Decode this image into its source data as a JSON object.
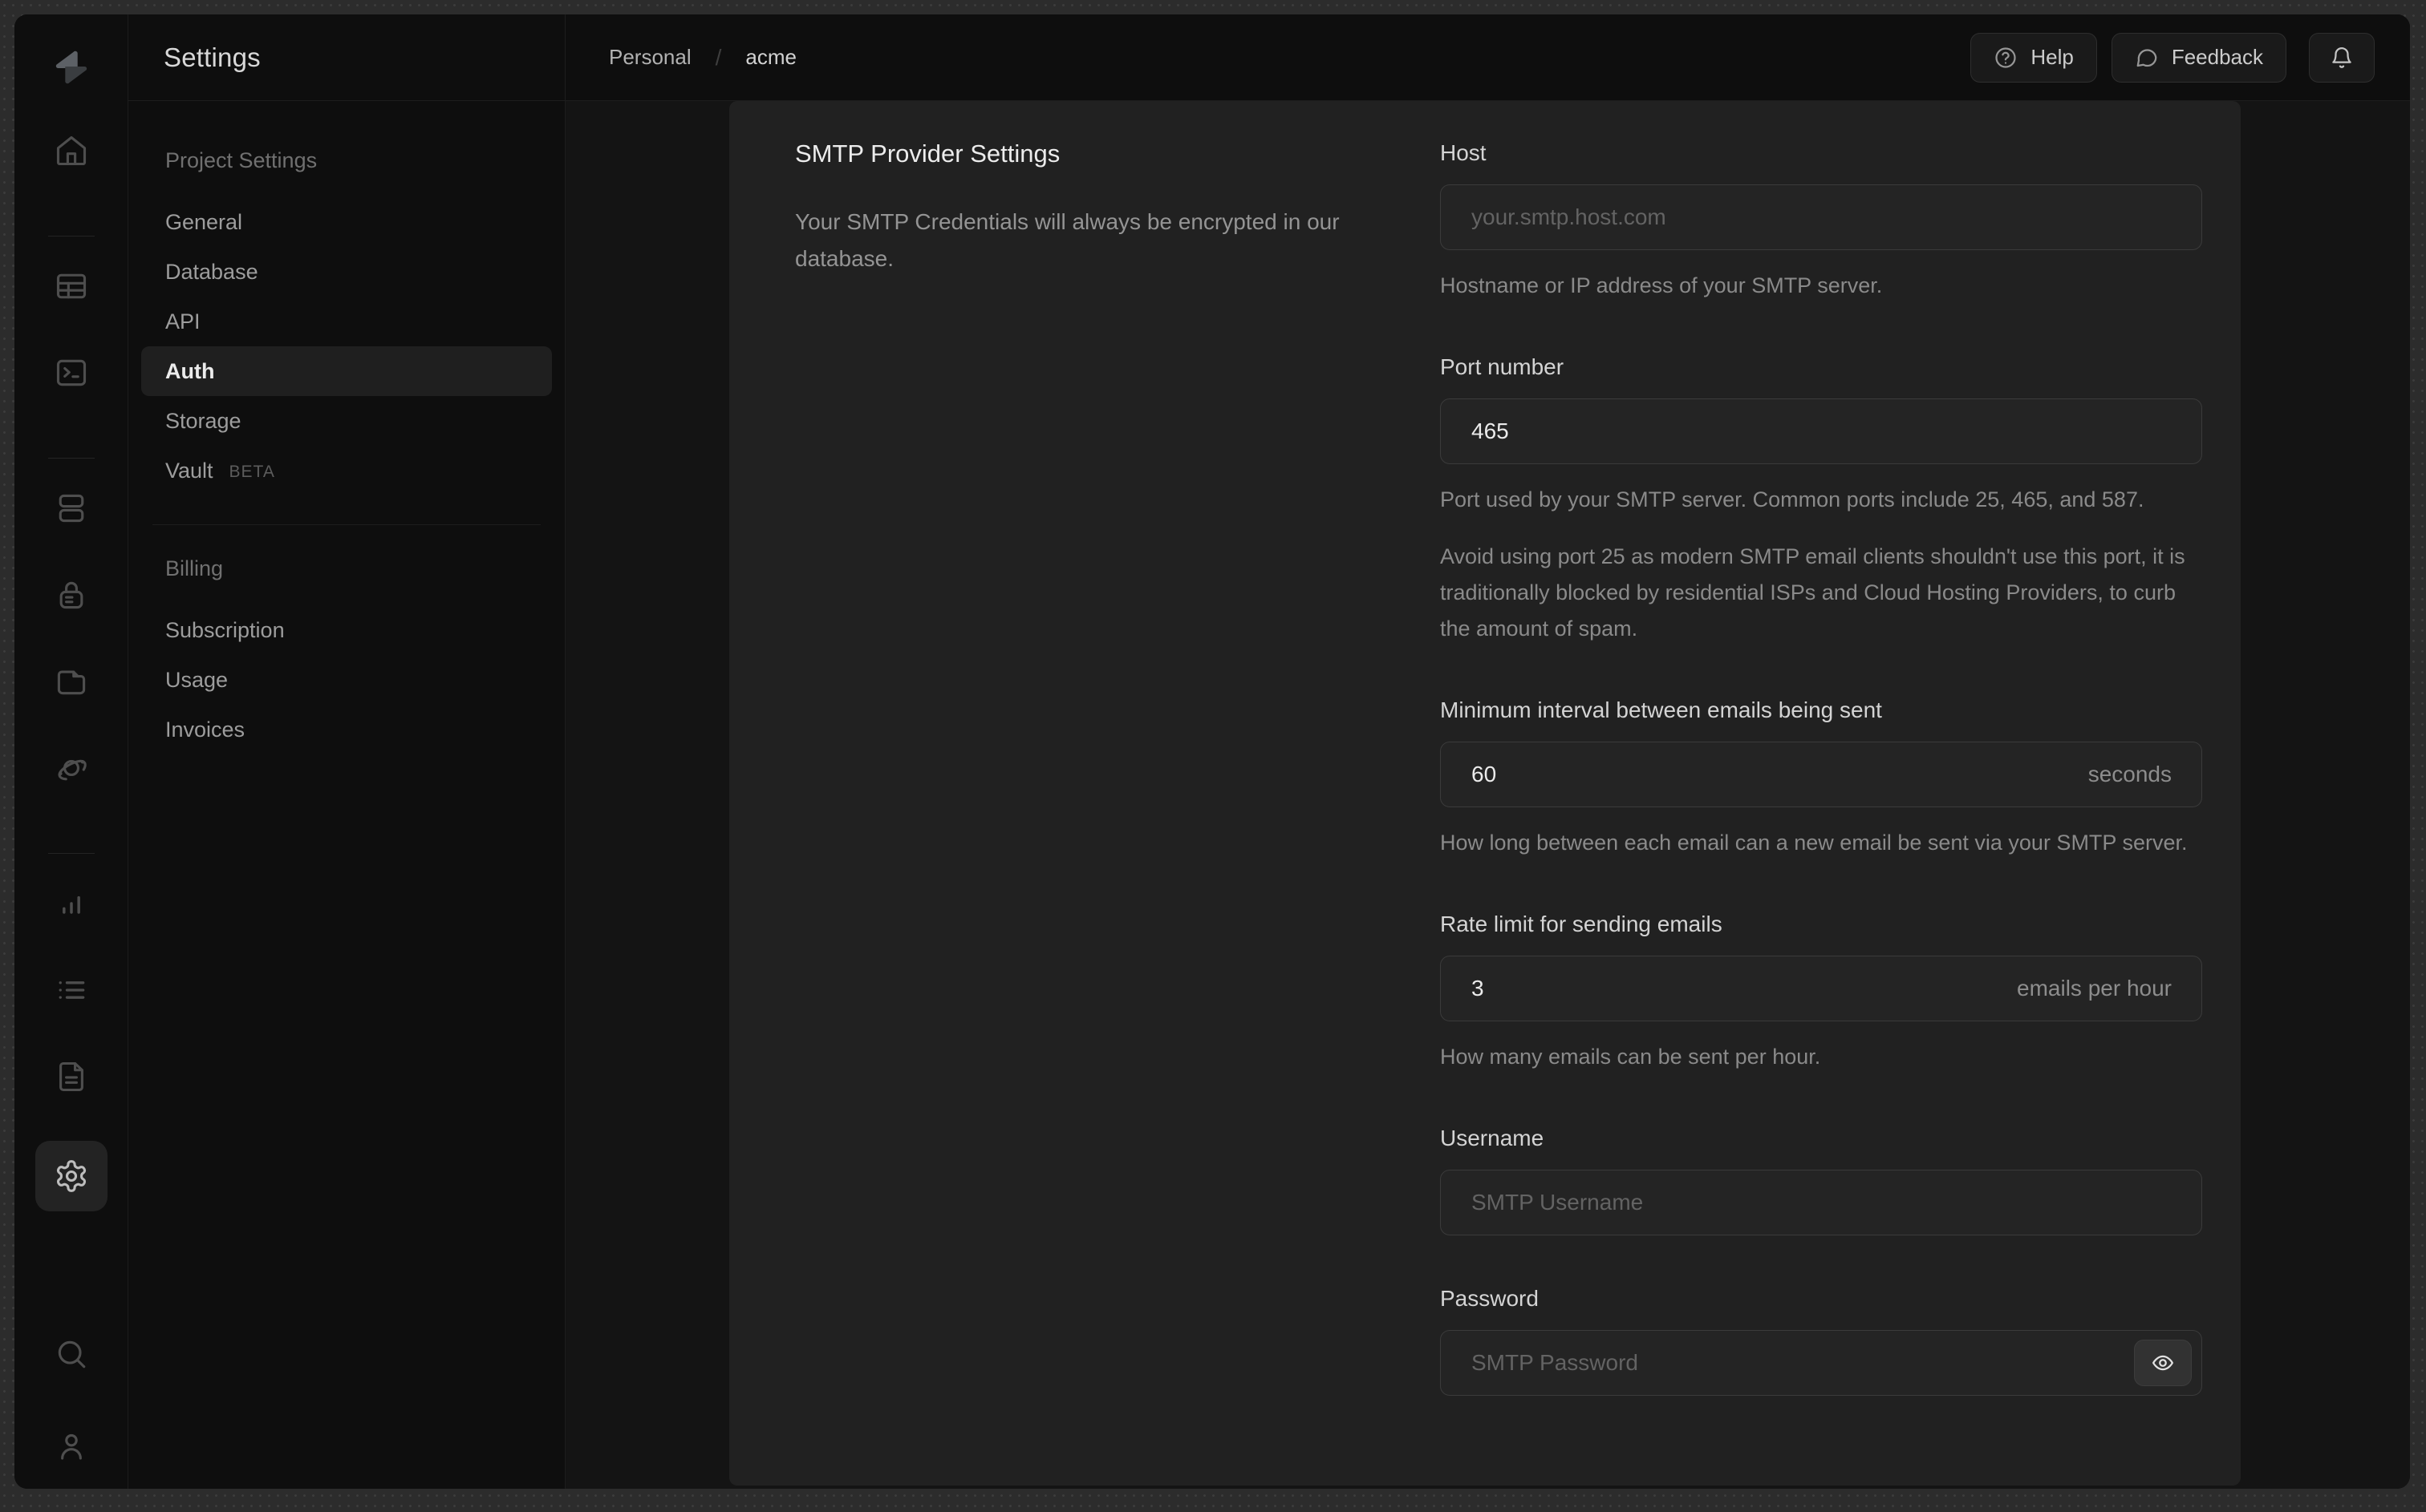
{
  "rail": {
    "logo": "supabase-logo",
    "icons_top": [
      "home",
      "table-editor",
      "sql-editor",
      "database",
      "auth",
      "storage",
      "edge-functions",
      "reports",
      "logs",
      "api-docs",
      "settings"
    ],
    "active_icon": "settings",
    "icons_bottom": [
      "search",
      "user"
    ]
  },
  "sidebar": {
    "title": "Settings",
    "sections": [
      {
        "label": "Project Settings",
        "items": [
          {
            "label": "General",
            "active": false
          },
          {
            "label": "Database",
            "active": false
          },
          {
            "label": "API",
            "active": false
          },
          {
            "label": "Auth",
            "active": true
          },
          {
            "label": "Storage",
            "active": false
          },
          {
            "label": "Vault",
            "badge": "BETA",
            "active": false
          }
        ]
      },
      {
        "label": "Billing",
        "items": [
          {
            "label": "Subscription",
            "active": false
          },
          {
            "label": "Usage",
            "active": false
          },
          {
            "label": "Invoices",
            "active": false
          }
        ]
      }
    ]
  },
  "topbar": {
    "breadcrumb": {
      "org": "Personal",
      "separator": "/",
      "project": "acme"
    },
    "help_label": "Help",
    "feedback_label": "Feedback",
    "bell_icon": "bell-icon"
  },
  "panel": {
    "heading": "SMTP Provider Settings",
    "description": "Your SMTP Credentials will always be encrypted in our database.",
    "fields": [
      {
        "label": "Host",
        "value": "",
        "placeholder": "your.smtp.host.com",
        "helpers": [
          "Hostname or IP address of your SMTP server."
        ]
      },
      {
        "label": "Port number",
        "value": "465",
        "helpers": [
          "Port used by your SMTP server. Common ports include 25, 465, and 587.",
          "Avoid using port 25 as modern SMTP email clients shouldn't use this port, it is traditionally blocked by residential ISPs and Cloud Hosting Providers, to curb the amount of spam."
        ]
      },
      {
        "label": "Minimum interval between emails being sent",
        "value": "60",
        "suffix": "seconds",
        "helpers": [
          "How long between each email can a new email be sent via your SMTP server."
        ]
      },
      {
        "label": "Rate limit for sending emails",
        "value": "3",
        "suffix": "emails per hour",
        "helpers": [
          "How many emails can be sent per hour."
        ]
      },
      {
        "label": "Username",
        "value": "",
        "placeholder": "SMTP Username",
        "helpers": []
      },
      {
        "label": "Password",
        "value": "",
        "placeholder": "SMTP Password",
        "has_reveal": true,
        "helpers": []
      }
    ]
  },
  "colors": {
    "app_bg": "#0e0e0e",
    "main_bg": "#141414",
    "panel_bg": "#212121",
    "input_bg": "#242424",
    "input_border": "#3b3b3b",
    "border": "#1d1d1d",
    "text_primary": "#ececec",
    "text_muted": "#8d8d8d"
  }
}
